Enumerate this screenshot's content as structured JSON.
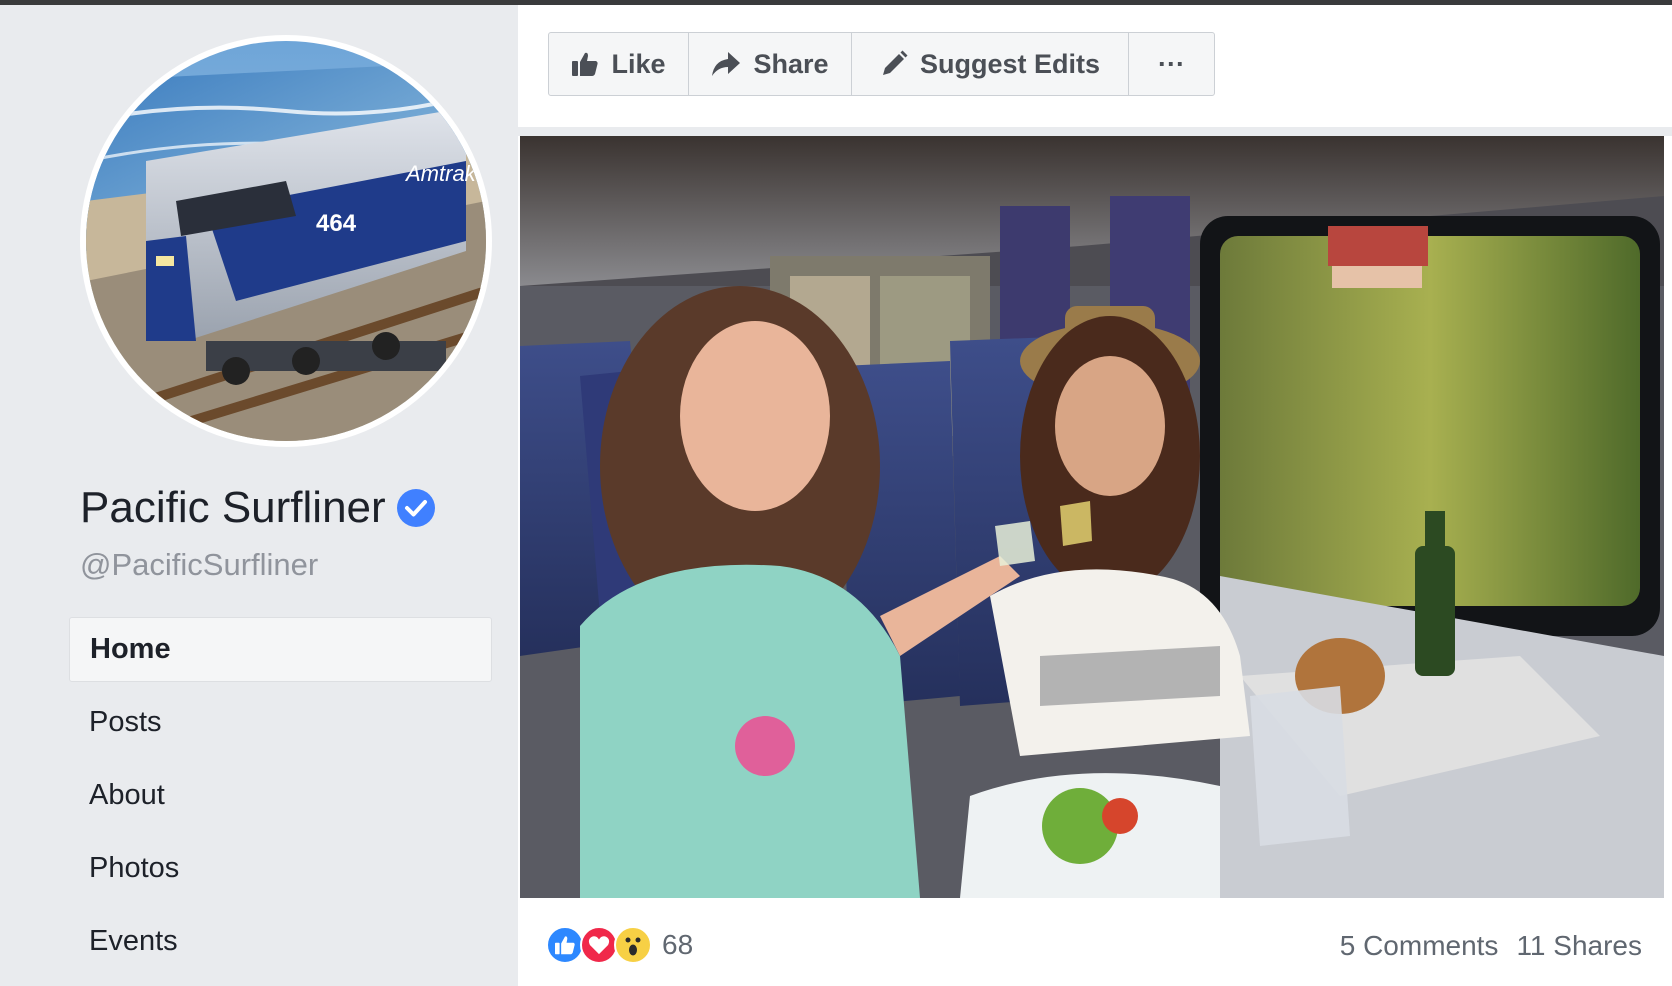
{
  "profile": {
    "name": "Pacific Surfliner",
    "handle": "@PacificSurfliner",
    "verified": true,
    "accent_color": "#4080ff"
  },
  "nav": {
    "items": [
      {
        "label": "Home",
        "active": true
      },
      {
        "label": "Posts",
        "active": false
      },
      {
        "label": "About",
        "active": false
      },
      {
        "label": "Photos",
        "active": false
      },
      {
        "label": "Events",
        "active": false
      }
    ]
  },
  "actions": {
    "like_label": "Like",
    "share_label": "Share",
    "suggest_label": "Suggest Edits",
    "more_label": "···"
  },
  "post": {
    "reaction_count": "68",
    "comments": "5 Comments",
    "shares": "11 Shares",
    "reactions": [
      "like-icon",
      "love-icon",
      "wow-icon"
    ]
  }
}
